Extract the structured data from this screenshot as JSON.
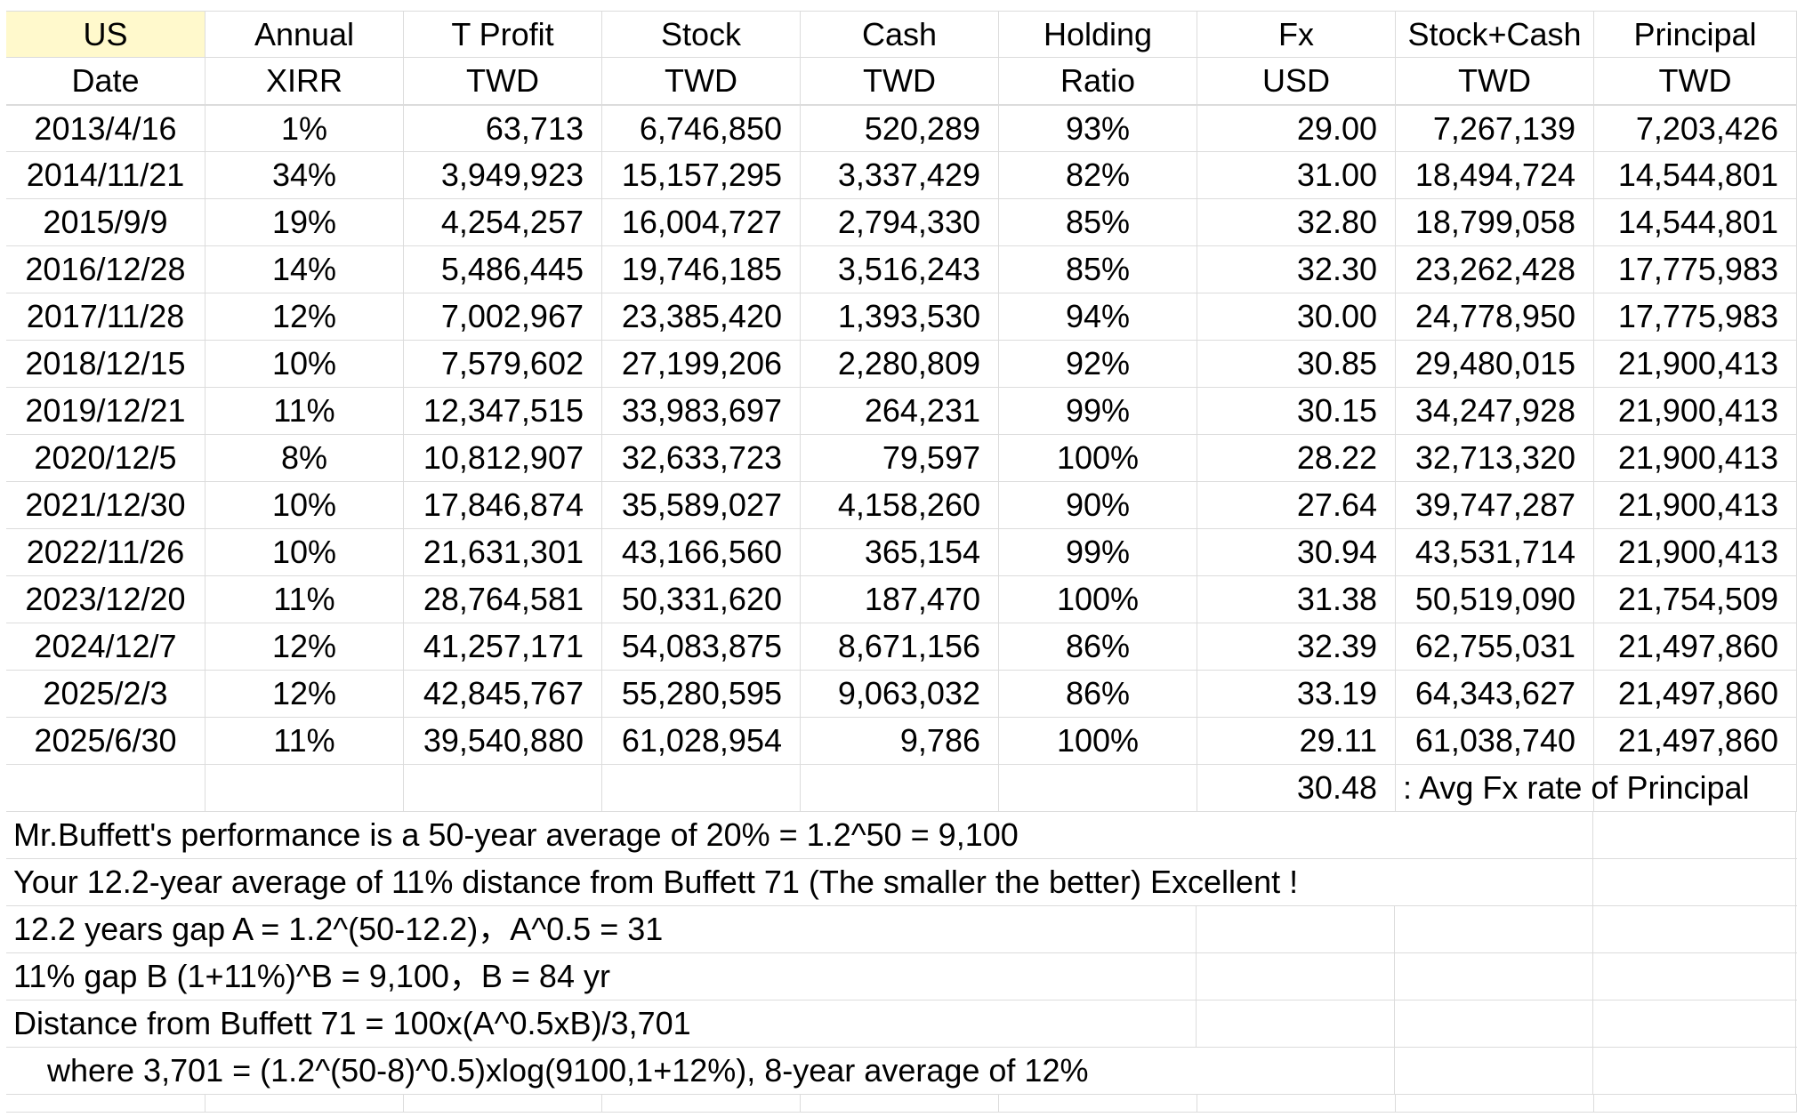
{
  "header": {
    "row1": [
      "US",
      "Annual",
      "T Profit",
      "Stock",
      "Cash",
      "Holding",
      "Fx",
      "Stock+Cash",
      "Principal"
    ],
    "row2": [
      "Date",
      "XIRR",
      "TWD",
      "TWD",
      "TWD",
      "Ratio",
      "USD",
      "TWD",
      "TWD"
    ]
  },
  "rows": [
    [
      "2013/4/16",
      "1%",
      "63,713",
      "6,746,850",
      "520,289",
      "93%",
      "29.00",
      "7,267,139",
      "7,203,426"
    ],
    [
      "2014/11/21",
      "34%",
      "3,949,923",
      "15,157,295",
      "3,337,429",
      "82%",
      "31.00",
      "18,494,724",
      "14,544,801"
    ],
    [
      "2015/9/9",
      "19%",
      "4,254,257",
      "16,004,727",
      "2,794,330",
      "85%",
      "32.80",
      "18,799,058",
      "14,544,801"
    ],
    [
      "2016/12/28",
      "14%",
      "5,486,445",
      "19,746,185",
      "3,516,243",
      "85%",
      "32.30",
      "23,262,428",
      "17,775,983"
    ],
    [
      "2017/11/28",
      "12%",
      "7,002,967",
      "23,385,420",
      "1,393,530",
      "94%",
      "30.00",
      "24,778,950",
      "17,775,983"
    ],
    [
      "2018/12/15",
      "10%",
      "7,579,602",
      "27,199,206",
      "2,280,809",
      "92%",
      "30.85",
      "29,480,015",
      "21,900,413"
    ],
    [
      "2019/12/21",
      "11%",
      "12,347,515",
      "33,983,697",
      "264,231",
      "99%",
      "30.15",
      "34,247,928",
      "21,900,413"
    ],
    [
      "2020/12/5",
      "8%",
      "10,812,907",
      "32,633,723",
      "79,597",
      "100%",
      "28.22",
      "32,713,320",
      "21,900,413"
    ],
    [
      "2021/12/30",
      "10%",
      "17,846,874",
      "35,589,027",
      "4,158,260",
      "90%",
      "27.64",
      "39,747,287",
      "21,900,413"
    ],
    [
      "2022/11/26",
      "10%",
      "21,631,301",
      "43,166,560",
      "365,154",
      "99%",
      "30.94",
      "43,531,714",
      "21,900,413"
    ],
    [
      "2023/12/20",
      "11%",
      "28,764,581",
      "50,331,620",
      "187,470",
      "100%",
      "31.38",
      "50,519,090",
      "21,754,509"
    ],
    [
      "2024/12/7",
      "12%",
      "41,257,171",
      "54,083,875",
      "8,671,156",
      "86%",
      "32.39",
      "62,755,031",
      "21,497,860"
    ],
    [
      "2025/2/3",
      "12%",
      "42,845,767",
      "55,280,595",
      "9,063,032",
      "86%",
      "33.19",
      "64,343,627",
      "21,497,860"
    ],
    [
      "2025/6/30",
      "11%",
      "39,540,880",
      "61,028,954",
      "9,786",
      "100%",
      "29.11",
      "61,038,740",
      "21,497,860"
    ]
  ],
  "avg_fx": {
    "value": "30.48",
    "label": ": Avg Fx rate of Principal"
  },
  "notes": [
    "Mr.Buffett's performance is a 50-year average of 20% = 1.2^50 = 9,100",
    "Your 12.2-year average of 11% distance from Buffett 71 (The smaller the better) Excellent !",
    "12.2 years gap A = 1.2^(50-12.2)，A^0.5 = 31",
    "11% gap B (1+11%)^B = 9,100，B = 84 yr",
    "Distance from Buffett 71 = 100x(A^0.5xB)/3,701",
    "where 3,701 = (1.2^(50-8)^0.5)xlog(9100,1+12%), 8-year average of 12%"
  ],
  "colors": {
    "header_highlight": "#fff9cc",
    "grid_line": "#dcdcdc"
  }
}
